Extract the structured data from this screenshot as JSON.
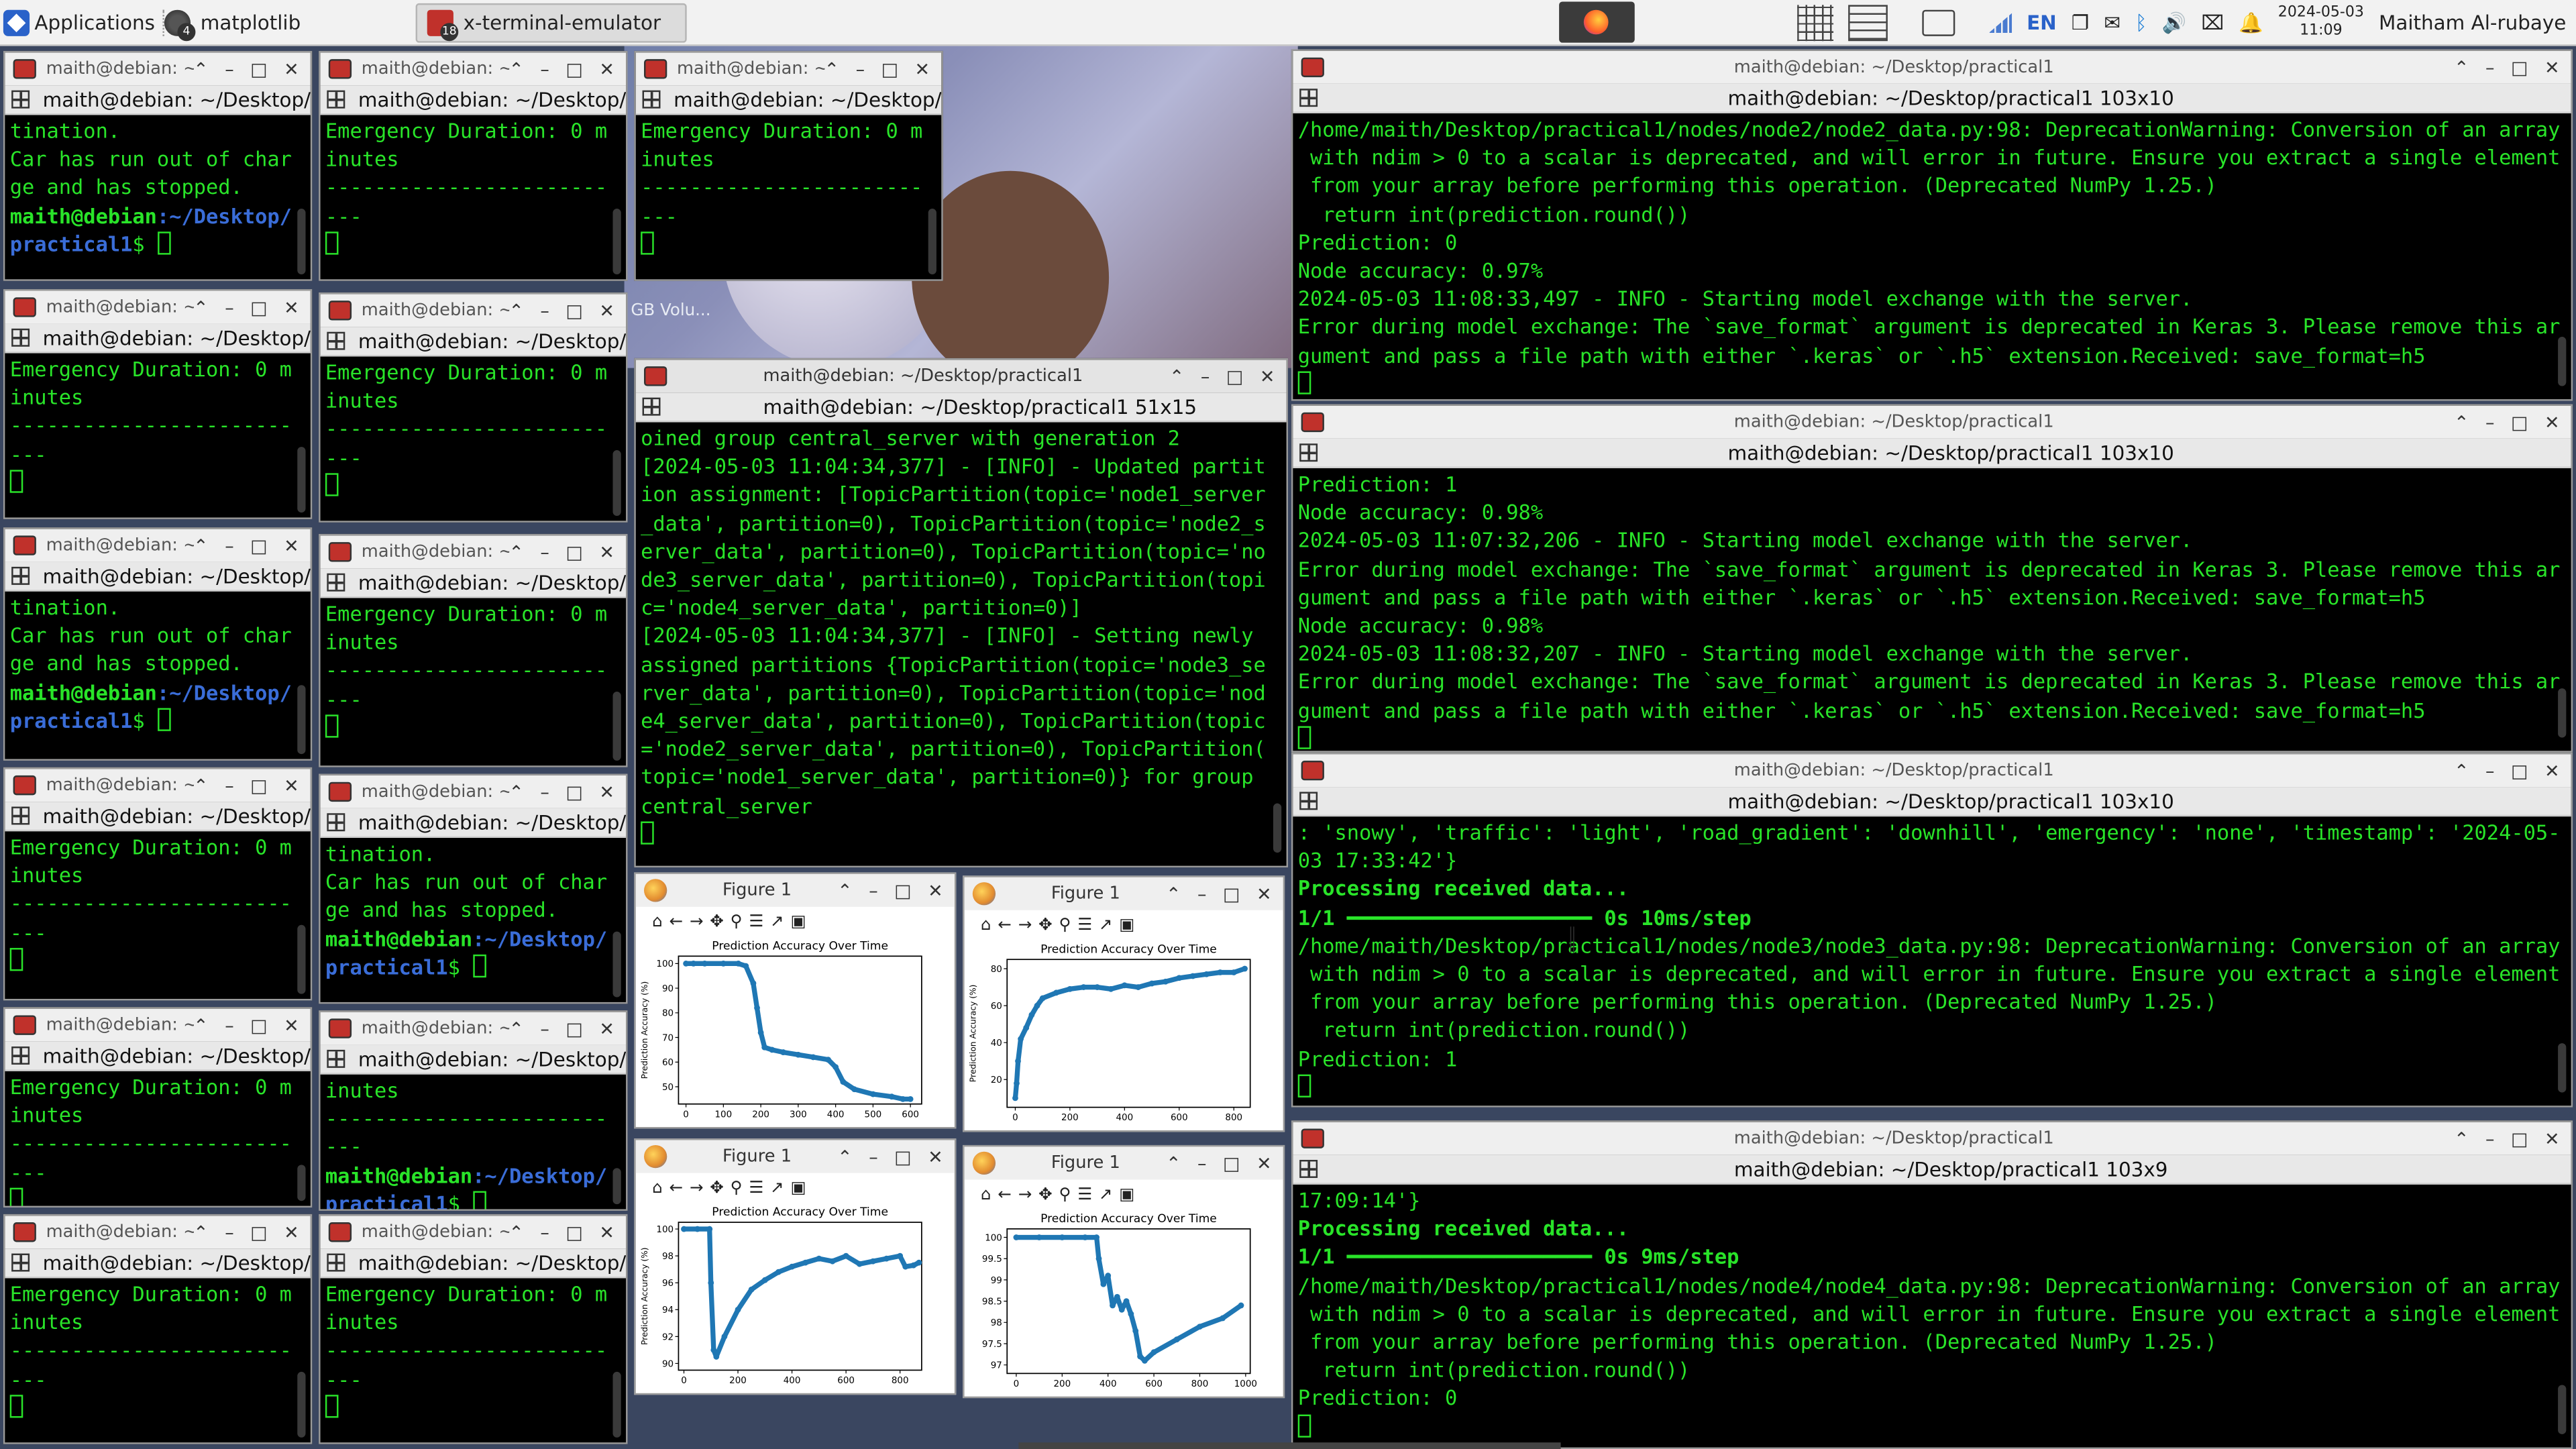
{
  "panel": {
    "apps_label": "Applications",
    "task_matplotlib": {
      "label": "matplotlib",
      "count": "4"
    },
    "task_terminal": {
      "label": "x-terminal-emulator",
      "count": "18"
    },
    "lang": "EN",
    "date": "2024-05-03",
    "time": "11:09",
    "user": "Maitham Al-rubaye"
  },
  "wallpaper_label": "GB Volu...",
  "small_terminals": [
    {
      "title": "maith@debian: ~/",
      "sub": "maith@debian: ~/Desktop/pra",
      "lines": [
        "tination.",
        "Car has run out of char",
        "ge and has stopped."
      ],
      "prompt": true
    },
    {
      "title": "maith@debian: ~/",
      "sub": "maith@debian: ~/Desktop/pra",
      "lines": [
        "Emergency Duration: 0 m",
        "inutes",
        "-----------------------",
        "---"
      ],
      "prompt": false
    },
    {
      "title": "maith@debian: ~/",
      "sub": "maith@debian: ~/Desktop/pra",
      "lines": [
        "Emergency Duration: 0 m",
        "inutes",
        "-----------------------",
        "---"
      ],
      "prompt": false
    },
    {
      "title": "maith@debian: ~/",
      "sub": "maith@debian: ~/Desktop/pra",
      "lines": [
        "Emergency Duration: 0 m",
        "inutes",
        "-----------------------",
        "---"
      ],
      "prompt": false
    },
    {
      "title": "maith@debian: ~/",
      "sub": "maith@debian: ~/Desktop/pra",
      "lines": [
        "Emergency Duration: 0 m",
        "inutes",
        "-----------------------",
        "---"
      ],
      "prompt": false
    },
    {
      "title": "maith@debian: ~/",
      "sub": "maith@debian: ~/Desktop/pra",
      "lines": [
        "tination.",
        "Car has run out of char",
        "ge and has stopped."
      ],
      "prompt": true
    },
    {
      "title": "maith@debian: ~/",
      "sub": "maith@debian: ~/Desktop/pra",
      "lines": [
        "Emergency Duration: 0 m",
        "inutes",
        "-----------------------",
        "---"
      ],
      "prompt": false
    },
    {
      "title": "maith@debian: ~/",
      "sub": "maith@debian: ~/Desktop/pra",
      "lines": [
        "Emergency Duration: 0 m",
        "inutes",
        "-----------------------",
        "---"
      ],
      "prompt": false
    },
    {
      "title": "maith@debian: ~/",
      "sub": "maith@debian: ~/Desktop/pra",
      "lines": [
        "tination.",
        "Car has run out of char",
        "ge and has stopped."
      ],
      "prompt": true
    },
    {
      "title": "maith@debian: ~/",
      "sub": "maith@debian: ~/Desktop/pra",
      "lines": [
        "Emergency Duration: 0 m",
        "inutes",
        "-----------------------",
        "---"
      ],
      "prompt": false
    },
    {
      "title": "maith@debian: ~/",
      "sub": "maith@debian: ~/Desktop/pra",
      "lines": [
        "inutes",
        "-----------------------",
        "---"
      ],
      "prompt": true
    },
    {
      "title": "maith@debian: ~/",
      "sub": "maith@debian: ~/Desktop/pra",
      "lines": [
        "Emergency Duration: 0 m",
        "inutes",
        "-----------------------",
        "---"
      ],
      "prompt": false
    },
    {
      "title": "maith@debian: ~/",
      "sub": "maith@debian: ~/Desktop/pra",
      "lines": [
        "Emergency Duration: 0 m",
        "inutes",
        "-----------------------",
        "---"
      ],
      "prompt": false
    }
  ],
  "prompt": {
    "user": "maith@debian",
    "path": ":~/Desktop/",
    "path2": "practical1",
    "sign": "$ "
  },
  "central": {
    "title": "maith@debian: ~/Desktop/practical1",
    "sub": "maith@debian: ~/Desktop/practical1 51x15",
    "lines": [
      "oined group central_server with generation 2",
      "[2024-05-03 11:04:34,377] - [INFO] - Updated partit",
      "ion assignment: [TopicPartition(topic='node1_server",
      "_data', partition=0), TopicPartition(topic='node2_s",
      "erver_data', partition=0), TopicPartition(topic='no",
      "de3_server_data', partition=0), TopicPartition(topi",
      "c='node4_server_data', partition=0)]",
      "[2024-05-03 11:04:34,377] - [INFO] - Setting newly",
      "assigned partitions {TopicPartition(topic='node3_se",
      "rver_data', partition=0), TopicPartition(topic='nod",
      "e4_server_data', partition=0), TopicPartition(topic",
      "='node2_server_data', partition=0), TopicPartition(",
      "topic='node1_server_data', partition=0)} for group",
      "central_server"
    ]
  },
  "big_terminals": [
    {
      "title": "maith@debian: ~/Desktop/practical1",
      "sub": "maith@debian: ~/Desktop/practical1 103x10",
      "lines": [
        "/home/maith/Desktop/practical1/nodes/node2/node2_data.py:98: DeprecationWarning: Conversion of an array",
        " with ndim > 0 to a scalar is deprecated, and will error in future. Ensure you extract a single element",
        " from your array before performing this operation. (Deprecated NumPy 1.25.)",
        "  return int(prediction.round())",
        "Prediction: 0",
        "Node accuracy: 0.97%",
        "2024-05-03 11:08:33,497 - INFO - Starting model exchange with the server.",
        "Error during model exchange: The `save_format` argument is deprecated in Keras 3. Please remove this ar",
        "gument and pass a file path with either `.keras` or `.h5` extension.Received: save_format=h5"
      ]
    },
    {
      "title": "maith@debian: ~/Desktop/practical1",
      "sub": "maith@debian: ~/Desktop/practical1 103x10",
      "lines": [
        "Prediction: 1",
        "Node accuracy: 0.98%",
        "2024-05-03 11:07:32,206 - INFO - Starting model exchange with the server.",
        "Error during model exchange: The `save_format` argument is deprecated in Keras 3. Please remove this ar",
        "gument and pass a file path with either `.keras` or `.h5` extension.Received: save_format=h5",
        "Node accuracy: 0.98%",
        "2024-05-03 11:08:32,207 - INFO - Starting model exchange with the server.",
        "Error during model exchange: The `save_format` argument is deprecated in Keras 3. Please remove this ar",
        "gument and pass a file path with either `.keras` or `.h5` extension.Received: save_format=h5"
      ]
    },
    {
      "title": "maith@debian: ~/Desktop/practical1",
      "sub": "maith@debian: ~/Desktop/practical1 103x10",
      "lines": [
        ": 'snowy', 'traffic': 'light', 'road_gradient': 'downhill', 'emergency': 'none', 'timestamp': '2024-05-",
        "03 17:33:42'}",
        "Processing received data...",
        "1/1 ━━━━━━━━━━━━━━━━━━━━ 0s 10ms/step",
        "/home/maith/Desktop/practical1/nodes/node3/node3_data.py:98: DeprecationWarning: Conversion of an array",
        " with ndim > 0 to a scalar is deprecated, and will error in future. Ensure you extract a single element",
        " from your array before performing this operation. (Deprecated NumPy 1.25.)",
        "  return int(prediction.round())",
        "Prediction: 1"
      ]
    },
    {
      "title": "maith@debian: ~/Desktop/practical1",
      "sub": "maith@debian: ~/Desktop/practical1 103x9",
      "lines": [
        "17:09:14'}",
        "Processing received data...",
        "1/1 ━━━━━━━━━━━━━━━━━━━━ 0s 9ms/step",
        "/home/maith/Desktop/practical1/nodes/node4/node4_data.py:98: DeprecationWarning: Conversion of an array",
        " with ndim > 0 to a scalar is deprecated, and will error in future. Ensure you extract a single element",
        " from your array before performing this operation. (Deprecated NumPy 1.25.)",
        "  return int(prediction.round())",
        "Prediction: 0"
      ]
    }
  ],
  "figures": [
    {
      "window_title": "Figure 1",
      "plot_title": "Prediction Accuracy Over Time",
      "ylabel": "Prediction Accuracy (%)"
    },
    {
      "window_title": "Figure 1",
      "plot_title": "Prediction Accuracy Over Time",
      "ylabel": "Prediction Accuracy (%)"
    },
    {
      "window_title": "Figure 1",
      "plot_title": "Prediction Accuracy Over Time",
      "ylabel": "Prediction Accuracy (%)"
    },
    {
      "window_title": "Figure 1",
      "plot_title": "Prediction Accuracy Over Time",
      "ylabel": ""
    }
  ],
  "chart_data": [
    {
      "type": "scatter",
      "title": "Prediction Accuracy Over Time",
      "ylabel": "Prediction Accuracy (%)",
      "xlim": [
        -20,
        630
      ],
      "ylim": [
        43,
        103
      ],
      "xticks": [
        0,
        100,
        200,
        300,
        400,
        500,
        600
      ],
      "yticks": [
        50,
        60,
        70,
        80,
        90,
        100
      ],
      "x": [
        0,
        20,
        50,
        100,
        140,
        160,
        180,
        190,
        200,
        210,
        230,
        260,
        300,
        340,
        380,
        400,
        420,
        450,
        500,
        550,
        580,
        600
      ],
      "y": [
        100,
        100,
        100,
        100,
        100,
        99,
        92,
        82,
        72,
        66,
        65,
        64,
        63,
        62,
        61,
        58,
        52,
        49,
        47,
        46,
        45,
        45
      ]
    },
    {
      "type": "scatter",
      "title": "Prediction Accuracy Over Time",
      "ylabel": "Prediction Accuracy (%)",
      "xlim": [
        -30,
        860
      ],
      "ylim": [
        5,
        85
      ],
      "xticks": [
        0,
        200,
        400,
        600,
        800
      ],
      "yticks": [
        20,
        40,
        60,
        80
      ],
      "x": [
        0,
        5,
        10,
        20,
        40,
        60,
        80,
        100,
        150,
        200,
        250,
        300,
        350,
        400,
        450,
        500,
        550,
        600,
        650,
        700,
        750,
        800,
        840
      ],
      "y": [
        10,
        18,
        30,
        42,
        48,
        55,
        60,
        64,
        67,
        69,
        70,
        70,
        69,
        71,
        70,
        72,
        73,
        75,
        76,
        77,
        78,
        78,
        80
      ]
    },
    {
      "type": "scatter",
      "title": "Prediction Accuracy Over Time",
      "ylabel": "Prediction Accuracy (%)",
      "xlim": [
        -20,
        880
      ],
      "ylim": [
        89.5,
        100.5
      ],
      "xticks": [
        0,
        200,
        400,
        600,
        800
      ],
      "yticks": [
        90,
        92,
        94,
        96,
        98,
        100
      ],
      "x": [
        0,
        50,
        95,
        100,
        110,
        120,
        150,
        200,
        250,
        300,
        350,
        400,
        450,
        500,
        550,
        600,
        650,
        700,
        750,
        800,
        820,
        850,
        870
      ],
      "y": [
        100,
        100,
        100,
        96,
        91,
        90.5,
        92,
        94,
        95.5,
        96.2,
        96.8,
        97.2,
        97.5,
        97.8,
        97.6,
        98,
        97.4,
        97.6,
        97.8,
        98,
        97.2,
        97.3,
        97.5
      ],
      "xlabel": ""
    },
    {
      "type": "scatter",
      "title": "Prediction Accuracy Over Time",
      "ylabel": "",
      "xlim": [
        -40,
        1020
      ],
      "ylim": [
        96.8,
        100.2
      ],
      "xticks": [
        0,
        200,
        400,
        600,
        800,
        1000
      ],
      "yticks": [
        97.0,
        97.5,
        98.0,
        98.5,
        99.0,
        99.5,
        100.0
      ],
      "x": [
        0,
        100,
        200,
        300,
        350,
        360,
        380,
        400,
        420,
        440,
        460,
        480,
        500,
        520,
        540,
        560,
        600,
        700,
        800,
        900,
        980
      ],
      "y": [
        100,
        100,
        100,
        100,
        100,
        99.5,
        98.9,
        99.1,
        98.4,
        98.6,
        98.3,
        98.5,
        98.2,
        97.8,
        97.2,
        97.1,
        97.3,
        97.6,
        97.9,
        98.1,
        98.4
      ]
    }
  ]
}
